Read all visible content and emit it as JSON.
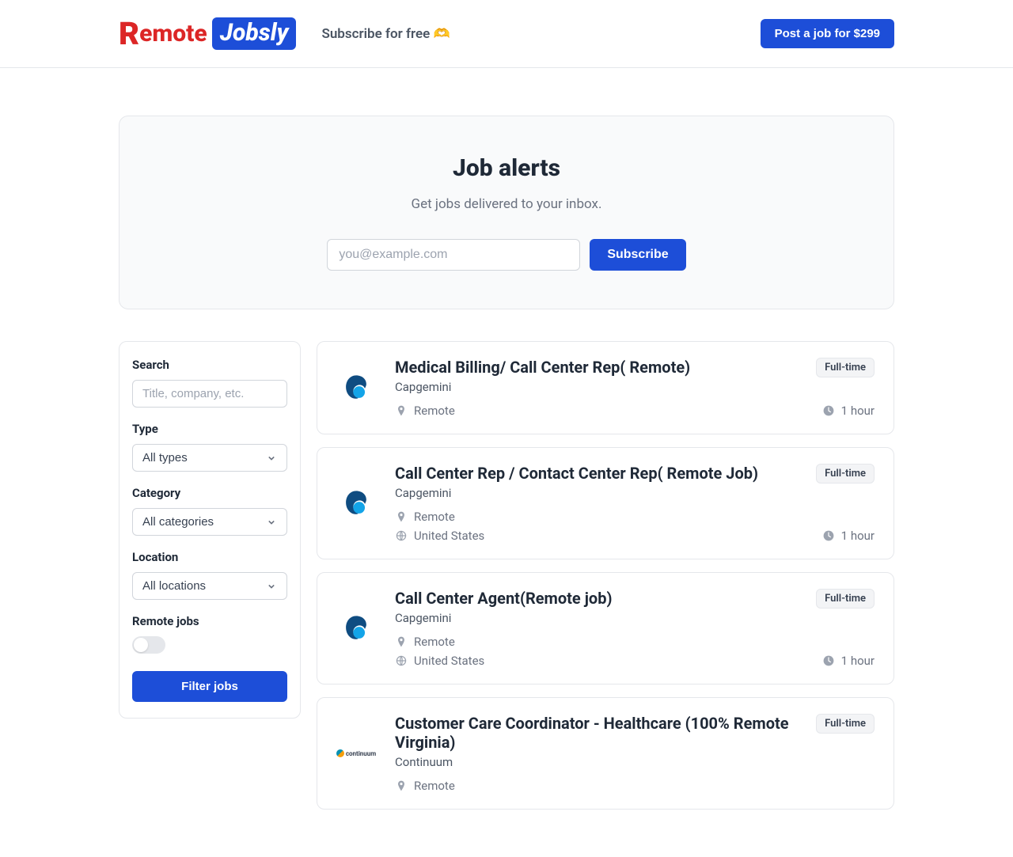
{
  "header": {
    "logo": {
      "r": "R",
      "emote": "emote",
      "jobsly": "Jobsly"
    },
    "subscribe_link": "Subscribe for free 🫶",
    "post_button": "Post a job for $299"
  },
  "alerts": {
    "title": "Job alerts",
    "subtitle": "Get jobs delivered to your inbox.",
    "placeholder": "you@example.com",
    "button": "Subscribe"
  },
  "filters": {
    "search_label": "Search",
    "search_placeholder": "Title, company, etc.",
    "type_label": "Type",
    "type_value": "All types",
    "category_label": "Category",
    "category_value": "All categories",
    "location_label": "Location",
    "location_value": "All locations",
    "remote_label": "Remote jobs",
    "filter_button": "Filter jobs"
  },
  "jobs": [
    {
      "title": "Medical Billing/ Call Center Rep( Remote)",
      "company": "Capgemini",
      "badge": "Full-time",
      "location": "Remote",
      "country": "",
      "time": "1 hour",
      "logo_type": "capgemini"
    },
    {
      "title": "Call Center Rep / Contact Center Rep( Remote Job)",
      "company": "Capgemini",
      "badge": "Full-time",
      "location": "Remote",
      "country": "United States",
      "time": "1 hour",
      "logo_type": "capgemini"
    },
    {
      "title": "Call Center Agent(Remote job)",
      "company": "Capgemini",
      "badge": "Full-time",
      "location": "Remote",
      "country": "United States",
      "time": "1 hour",
      "logo_type": "capgemini"
    },
    {
      "title": "Customer Care Coordinator - Healthcare (100% Remote Virginia)",
      "company": "Continuum",
      "badge": "Full-time",
      "location": "Remote",
      "country": "",
      "time": "",
      "logo_type": "continuum"
    }
  ]
}
